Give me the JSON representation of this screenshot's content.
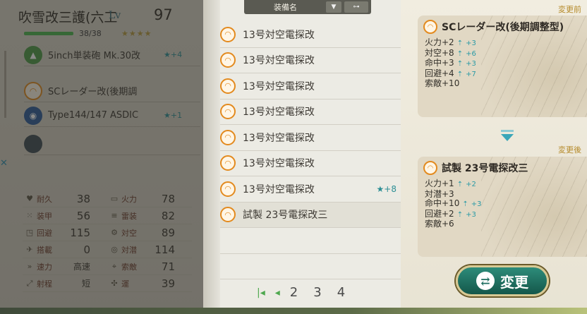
{
  "ship": {
    "name": "吹雪改三護(六工",
    "lv_label": "Lv",
    "level": "97",
    "hp_text": "38/38",
    "stars": "★★★★",
    "slots": [
      {
        "name": "5inch単装砲 Mk.30改",
        "improvement": "★+4",
        "icon": "gun-icon"
      },
      {
        "name": "SCレーダー改(後期調",
        "improvement": "",
        "icon": "radar-icon"
      },
      {
        "name": "Type144/147 ASDIC",
        "improvement": "★+1",
        "icon": "sonar-icon"
      },
      {
        "name": "",
        "improvement": "",
        "icon": "empty-slot-icon"
      }
    ],
    "stats": [
      {
        "label": "耐久",
        "value": "38",
        "label2": "火力",
        "value2": "78"
      },
      {
        "label": "装甲",
        "value": "56",
        "label2": "雷装",
        "value2": "82"
      },
      {
        "label": "回避",
        "value": "115",
        "label2": "対空",
        "value2": "89"
      },
      {
        "label": "搭載",
        "value": "0",
        "label2": "対潜",
        "value2": "114"
      },
      {
        "label": "速力",
        "value": "高速",
        "label2": "索敵",
        "value2": "71"
      },
      {
        "label": "射程",
        "value": "短",
        "label2": "運",
        "value2": "39"
      }
    ]
  },
  "list": {
    "header_label": "装備名",
    "items": [
      {
        "name": "13号対空電探改",
        "improvement": ""
      },
      {
        "name": "13号対空電探改",
        "improvement": ""
      },
      {
        "name": "13号対空電探改",
        "improvement": ""
      },
      {
        "name": "13号対空電探改",
        "improvement": ""
      },
      {
        "name": "13号対空電探改",
        "improvement": ""
      },
      {
        "name": "13号対空電探改",
        "improvement": ""
      },
      {
        "name": "13号対空電探改",
        "improvement": "★+8"
      },
      {
        "name": "試製 23号電探改三",
        "improvement": ""
      }
    ],
    "pager": {
      "first": "|◂",
      "prev": "◂",
      "pages": [
        "2",
        "3",
        "4"
      ]
    }
  },
  "compare": {
    "before_label": "変更前",
    "after_label": "変更後",
    "before": {
      "name": "SCレーダー改(後期調整型)",
      "stats": [
        {
          "text": "火力+2",
          "up": "+3"
        },
        {
          "text": "対空+8",
          "up": "+6"
        },
        {
          "text": "命中+3",
          "up": "+3"
        },
        {
          "text": "回避+4",
          "up": "+7"
        },
        {
          "text": "索敵+10",
          "up": ""
        }
      ]
    },
    "after": {
      "name": "試製 23号電探改三",
      "stats": [
        {
          "text": "火力+1",
          "up": "+2"
        },
        {
          "text": "対潜+3",
          "up": ""
        },
        {
          "text": "命中+10",
          "up": "+3"
        },
        {
          "text": "回避+2",
          "up": "+3"
        },
        {
          "text": "索敵+6",
          "up": ""
        }
      ]
    },
    "change_button": "変更"
  }
}
